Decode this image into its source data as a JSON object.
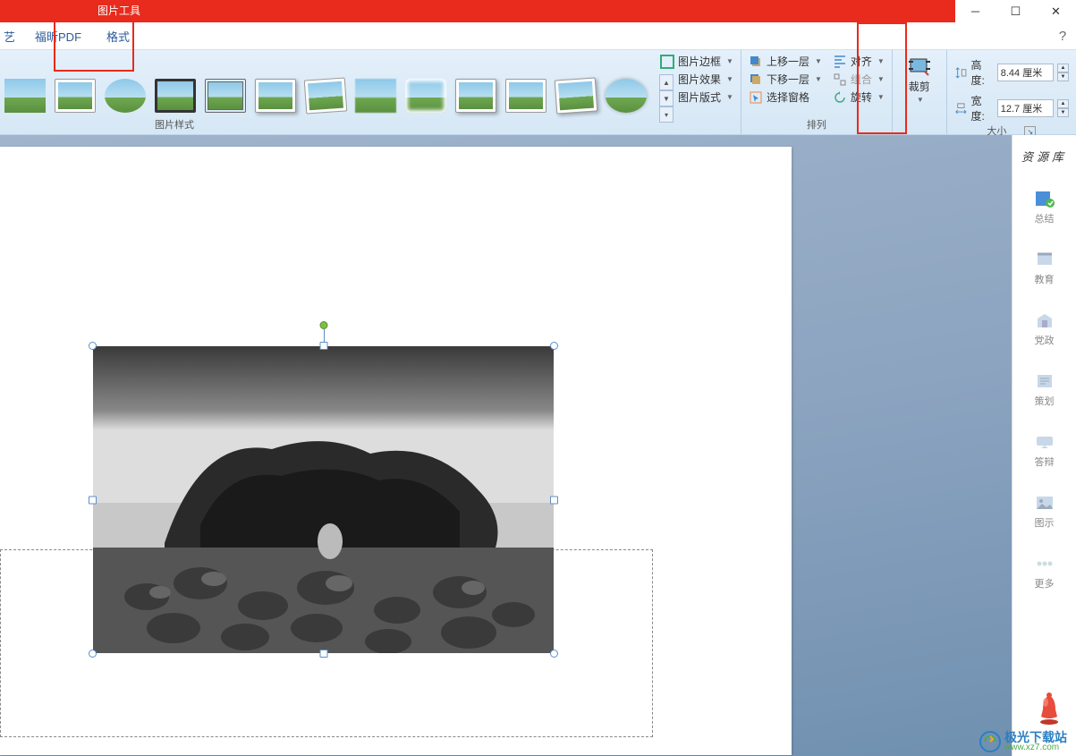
{
  "titlebar": {
    "picture_tools": "图片工具"
  },
  "tabs": {
    "partial": "艺",
    "foxit_pdf": "福昕PDF",
    "format": "格式"
  },
  "ribbon": {
    "styles_label": "图片样式",
    "pic_border": "图片边框",
    "pic_effects": "图片效果",
    "pic_layout": "图片版式",
    "bring_forward": "上移一层",
    "send_backward": "下移一层",
    "selection_pane": "选择窗格",
    "align": "对齐",
    "group": "组合",
    "rotate": "旋转",
    "arrange_label": "排列",
    "crop": "裁剪",
    "height_label": "高度:",
    "height_value": "8.44 厘米",
    "width_label": "宽度:",
    "width_value": "12.7 厘米",
    "size_label": "大小"
  },
  "side": {
    "title": "资源库",
    "summary": "总结",
    "education": "教育",
    "party": "党政",
    "plan": "策划",
    "defense": "答辩",
    "gallery": "图示",
    "more": "更多"
  },
  "watermark": {
    "main": "极光下载站",
    "sub": "www.xz7.com"
  }
}
